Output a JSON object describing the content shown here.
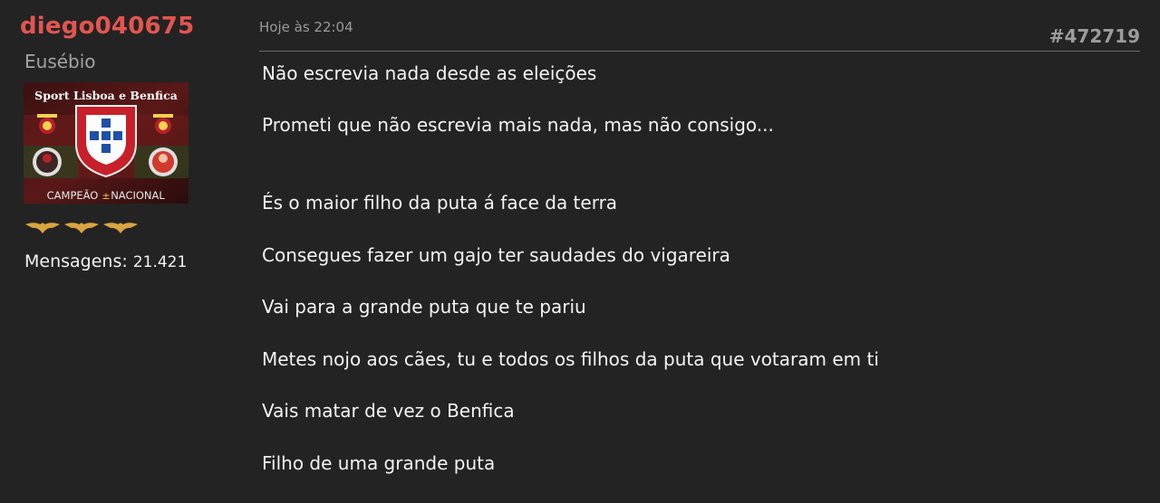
{
  "user": {
    "name": "diego040675",
    "rank": "Eusébio",
    "avatar": {
      "banner_text": "Sport Lisboa e Benfica",
      "caption_left": "CAMPEÃO",
      "caption_right": "NACIONAL"
    },
    "messages_label": "Mensagens:",
    "messages_count": "21.421"
  },
  "post": {
    "timestamp": "Hoje às 22:04",
    "number": "#472719",
    "lines": [
      "Não escrevia nada desde as eleições",
      "Prometi que não escrevia mais nada, mas não consigo...",
      "És o maior filho da puta á face da terra",
      "Consegues fazer um gajo ter saudades do vigareira",
      "Vai para a grande puta que te pariu",
      "Metes nojo aos cães, tu e todos os filhos da puta que votaram em ti",
      "Vais matar de vez o Benfica",
      "Filho de uma grande puta"
    ]
  },
  "colors": {
    "background": "#232323",
    "username": "#e4554f",
    "muted": "#9a9a9a",
    "text": "#f4f4f4",
    "wings": "#d9a441"
  },
  "icons": [
    "benfica-crest-icon",
    "portugal-shield-icon",
    "rank-wings-icon"
  ]
}
